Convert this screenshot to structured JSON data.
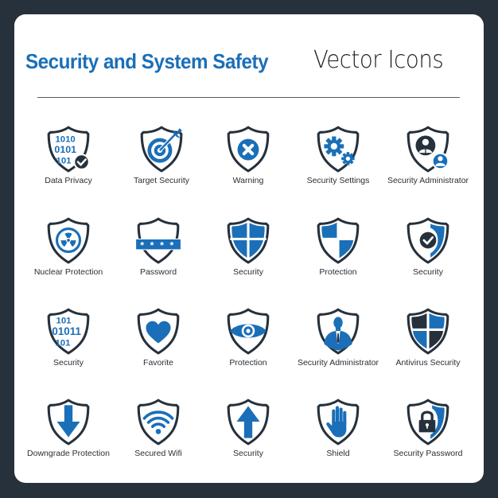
{
  "header": {
    "title_bold": "Security and System Safety",
    "title_light": "Vector Icons"
  },
  "colors": {
    "background": "#27313b",
    "card": "#ffffff",
    "accent_blue": "#1a6fb8",
    "dark_navy": "#26313c"
  },
  "icons": [
    {
      "label": "Data Privacy",
      "icon": "binary-shield-check-icon"
    },
    {
      "label": "Target Security",
      "icon": "target-arrow-shield-icon"
    },
    {
      "label": "Warning",
      "icon": "x-circle-shield-icon"
    },
    {
      "label": "Security Settings",
      "icon": "gears-shield-icon"
    },
    {
      "label": "Security Administrator",
      "icon": "user-badge-shield-icon"
    },
    {
      "label": "Nuclear Protection",
      "icon": "radiation-shield-icon"
    },
    {
      "label": "Password",
      "icon": "password-shield-icon"
    },
    {
      "label": "Security",
      "icon": "quartered-shield-icon"
    },
    {
      "label": "Protection",
      "icon": "checkered-shield-icon"
    },
    {
      "label": "Security",
      "icon": "checkmark-shield-icon"
    },
    {
      "label": "Security",
      "icon": "binary-shield-icon"
    },
    {
      "label": "Favorite",
      "icon": "heart-shield-icon"
    },
    {
      "label": "Protection",
      "icon": "eye-shield-icon"
    },
    {
      "label": "Security Administrator",
      "icon": "businessman-shield-icon"
    },
    {
      "label": "Antivirus Security",
      "icon": "antivirus-shield-icon"
    },
    {
      "label": "Downgrade Protection",
      "icon": "down-arrow-shield-icon"
    },
    {
      "label": "Secured Wifi",
      "icon": "wifi-shield-icon"
    },
    {
      "label": "Security",
      "icon": "up-arrow-shield-icon"
    },
    {
      "label": "Shield",
      "icon": "hand-shield-icon"
    },
    {
      "label": "Security Password",
      "icon": "padlock-shield-icon"
    }
  ]
}
